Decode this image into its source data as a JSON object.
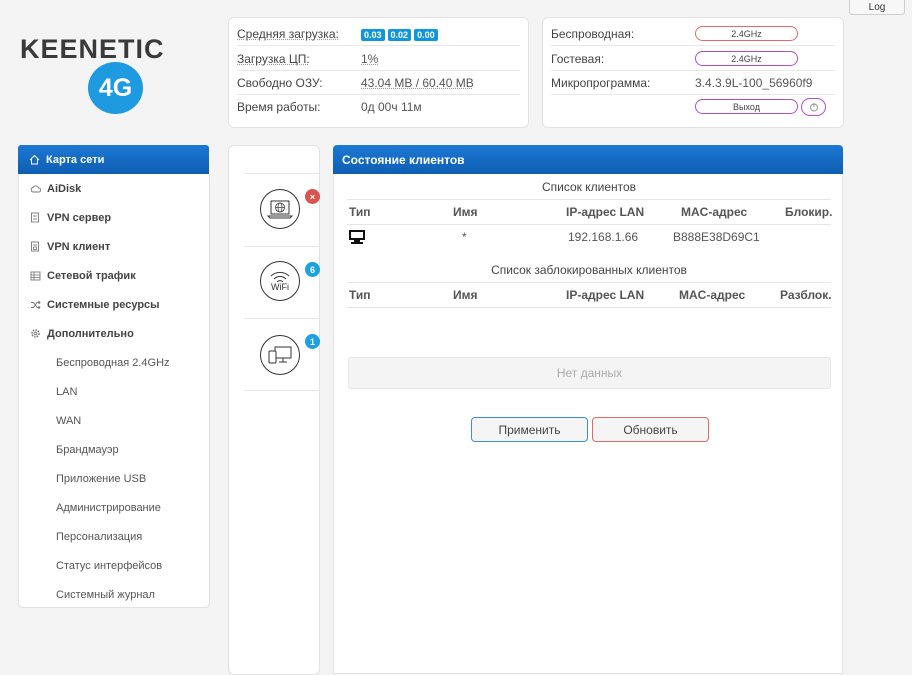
{
  "header": {
    "log_label": "Log",
    "logo_text": "KEENETIC",
    "logo_badge": "4G"
  },
  "status": {
    "load_label": "Средняя загрузка:",
    "load_values": [
      "0.03",
      "0.02",
      "0.00"
    ],
    "cpu_label": "Загрузка ЦП:",
    "cpu_value": "1%",
    "ram_label": "Свободно ОЗУ:",
    "ram_value": "43.04 MB / 60.40 MB",
    "uptime_label": "Время работы:",
    "uptime_value": "0д 00ч 11м"
  },
  "wireless": {
    "wireless_label": "Беспроводная:",
    "wireless_value": "2.4GHz",
    "guest_label": "Гостевая:",
    "guest_value": "2.4GHz",
    "firmware_label": "Микропрограмма:",
    "firmware_value": "3.4.3.9L-100_56960f9",
    "logout_label": "Выход"
  },
  "sidebar": {
    "items": [
      {
        "label": "Карта сети",
        "icon": "home-icon"
      },
      {
        "label": "AiDisk",
        "icon": "cloud-icon"
      },
      {
        "label": "VPN сервер",
        "icon": "vpn-server-icon"
      },
      {
        "label": "VPN клиент",
        "icon": "vpn-client-icon"
      },
      {
        "label": "Сетевой трафик",
        "icon": "traffic-icon"
      },
      {
        "label": "Системные ресурсы",
        "icon": "shuffle-icon"
      },
      {
        "label": "Дополнительно",
        "icon": "gear-icon"
      }
    ],
    "sub_items": [
      "Беспроводная 2.4GHz",
      "LAN",
      "WAN",
      "Брандмауэр",
      "Приложение USB",
      "Администрирование",
      "Персонализация",
      "Статус интерфейсов",
      "Системный журнал"
    ]
  },
  "devices": {
    "internet_badge": "×",
    "wifi_label": "WiFi",
    "wifi_badge": "6",
    "clients_badge": "1",
    "colors": {
      "error": "#d9534f",
      "info": "#1ba1e2"
    }
  },
  "panel": {
    "title": "Состояние клиентов",
    "clients_title": "Список клиентов",
    "columns": [
      "Тип",
      "Имя",
      "IP-адрес LAN",
      "MAC-адрес",
      "Блокир."
    ],
    "rows": [
      {
        "type_icon": "desktop-icon",
        "name": "*",
        "ip": "192.168.1.66",
        "mac": "B888E38D69C1",
        "block": ""
      }
    ],
    "blocked_title": "Список заблокированных клиентов",
    "blocked_columns": [
      "Тип",
      "Имя",
      "IP-адрес LAN",
      "MAC-адрес",
      "Разблок."
    ],
    "no_data": "Нет данных",
    "apply_label": "Применить",
    "refresh_label": "Обновить"
  },
  "colors": {
    "accent": "#1c78d4",
    "badge": "#1296db"
  }
}
